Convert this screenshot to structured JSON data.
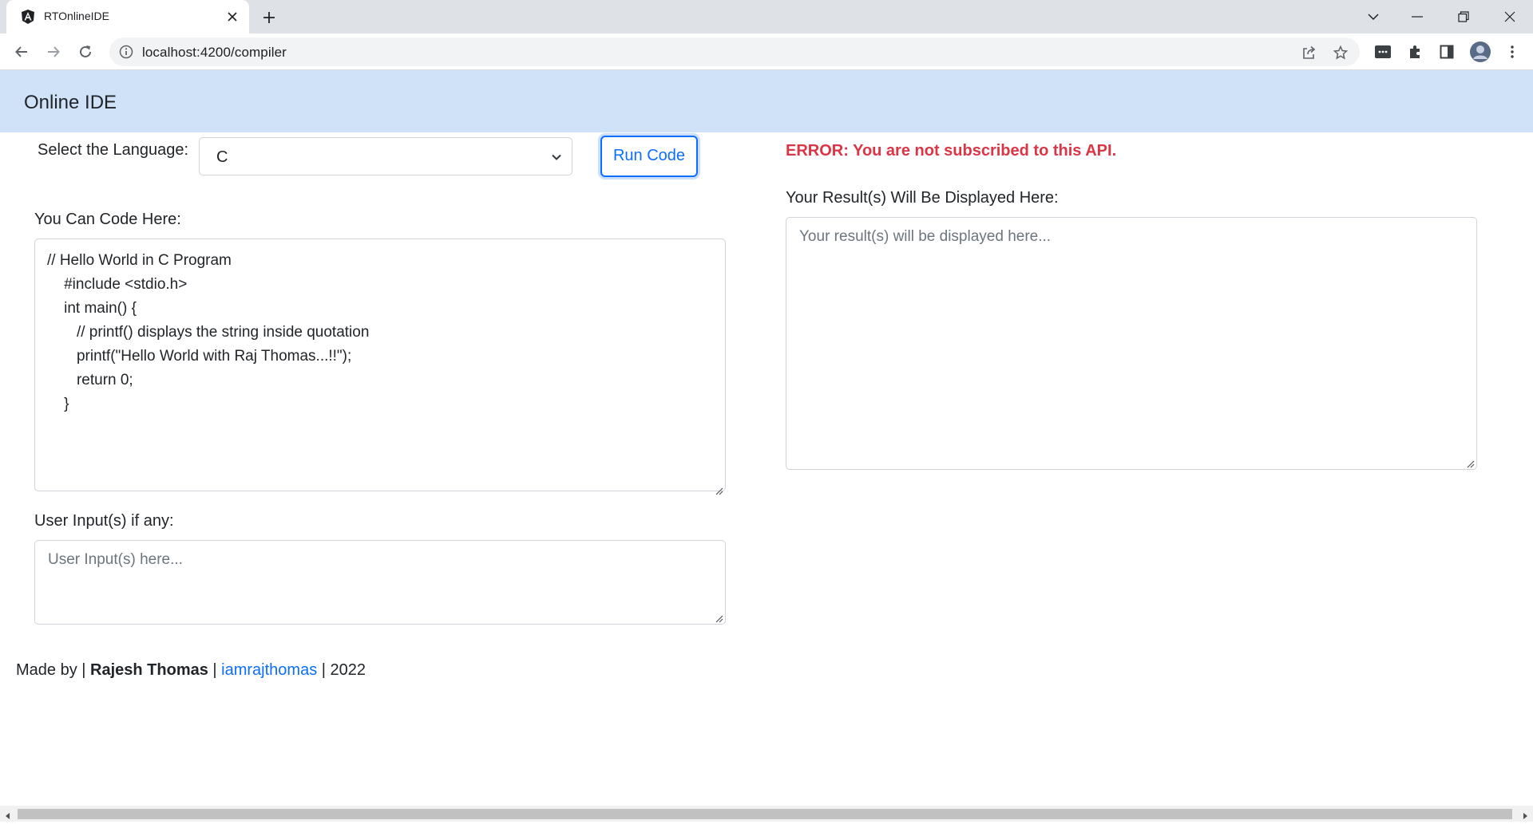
{
  "browser": {
    "tab_title": "RTOnlineIDE",
    "url": "localhost:4200/compiler"
  },
  "navbar": {
    "brand": "Online IDE"
  },
  "language": {
    "label": "Select the Language:",
    "selected": "C"
  },
  "run_button": "Run Code",
  "editor": {
    "label": "You Can Code Here:",
    "lines": [
      "// Hello World in C Program",
      "    #include <stdio.h>",
      "    int main() {",
      "       // printf() displays the string inside quotation",
      "       printf(\"Hello World with Raj Thomas...!!\");",
      "       return 0;",
      "    }"
    ]
  },
  "user_input": {
    "label": "User Input(s) if any:",
    "placeholder": "User Input(s) here..."
  },
  "error": "ERROR: You are not subscribed to this API.",
  "result": {
    "label": "Your Result(s) Will Be Displayed Here:",
    "placeholder": "Your result(s) will be displayed here..."
  },
  "footer": {
    "prefix": "Made by | ",
    "author": "Rajesh Thomas",
    "sep1": " | ",
    "handle": "iamrajthomas",
    "sep2": " | 2022"
  },
  "colors": {
    "navbar_bg": "#cfe2f8",
    "primary": "#0d6efd",
    "error": "#dc3545"
  }
}
